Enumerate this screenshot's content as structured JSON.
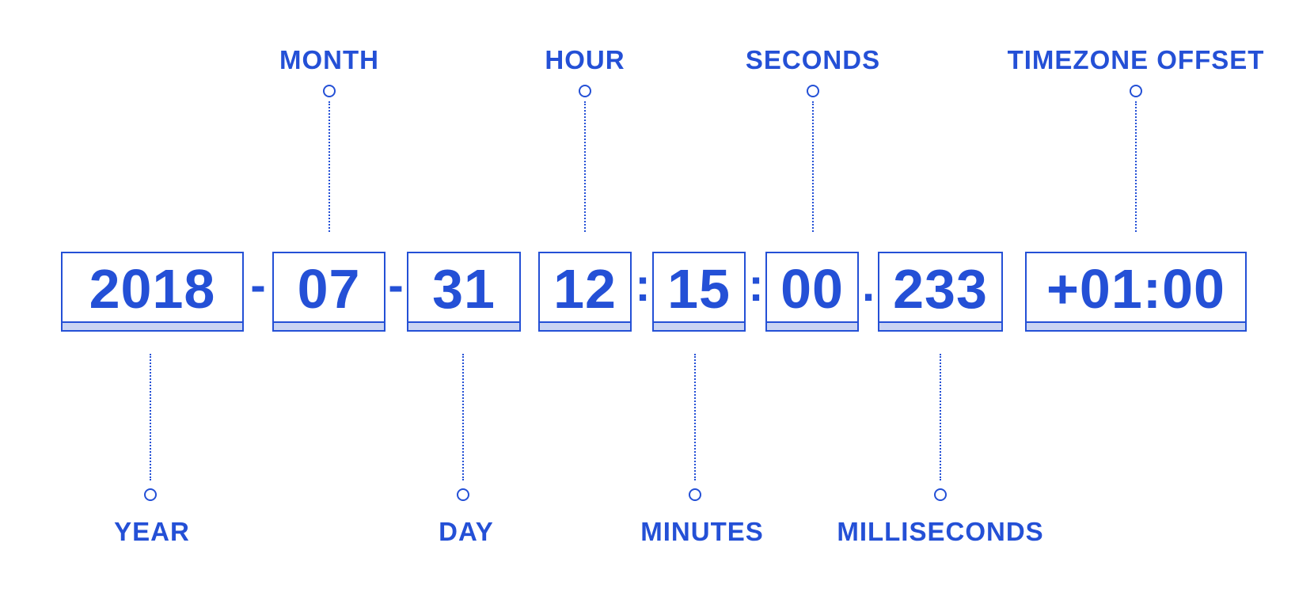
{
  "diagram": {
    "segments": [
      {
        "key": "year",
        "value": "2018",
        "label": "YEAR"
      },
      {
        "key": "month",
        "value": "07",
        "label": "MONTH"
      },
      {
        "key": "day",
        "value": "31",
        "label": "DAY"
      },
      {
        "key": "hour",
        "value": "12",
        "label": "HOUR"
      },
      {
        "key": "minutes",
        "value": "15",
        "label": "MINUTES"
      },
      {
        "key": "seconds",
        "value": "00",
        "label": "SECONDS"
      },
      {
        "key": "milliseconds",
        "value": "233",
        "label": "MILLISECONDS"
      },
      {
        "key": "timezone",
        "value": "+01:00",
        "label": "TIMEZONE OFFSET"
      }
    ],
    "separators": [
      "-",
      "-",
      ":",
      ":",
      "."
    ],
    "accent_color": "#2450d6",
    "box_base_color": "#c9d4f3"
  }
}
